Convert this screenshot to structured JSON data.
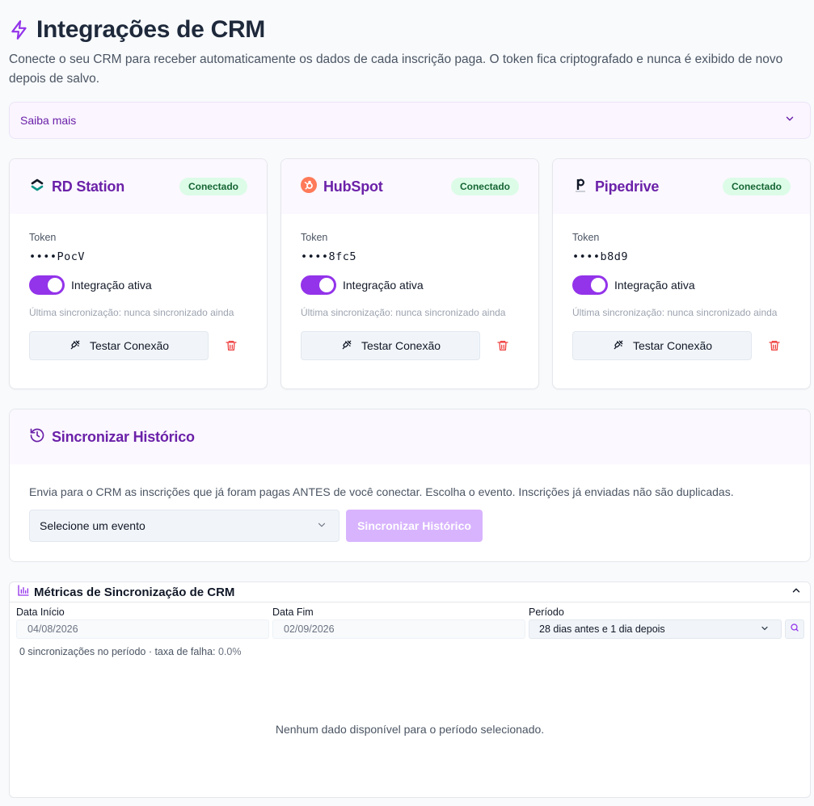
{
  "header": {
    "title": "Integrações de CRM",
    "subtitle": "Conecte o seu CRM para receber automaticamente os dados de cada inscrição paga. O token fica criptografado e nunca é exibido de novo depois de salvo."
  },
  "saiba_mais": {
    "label": "Saiba mais"
  },
  "integrations": [
    {
      "name": "RD Station",
      "status": "Conectado",
      "token_label": "Token",
      "token": "••••PocV",
      "toggle_label": "Integração ativa",
      "active": true,
      "last_sync": "Última sincronização: nunca sincronizado ainda",
      "test_label": "Testar Conexão"
    },
    {
      "name": "HubSpot",
      "status": "Conectado",
      "token_label": "Token",
      "token": "••••8fc5",
      "toggle_label": "Integração ativa",
      "active": true,
      "last_sync": "Última sincronização: nunca sincronizado ainda",
      "test_label": "Testar Conexão"
    },
    {
      "name": "Pipedrive",
      "status": "Conectado",
      "token_label": "Token",
      "token": "••••b8d9",
      "toggle_label": "Integração ativa",
      "active": true,
      "last_sync": "Última sincronização: nunca sincronizado ainda",
      "test_label": "Testar Conexão"
    }
  ],
  "history_sync": {
    "title": "Sincronizar Histórico",
    "description": "Envia para o CRM as inscrições que já foram pagas ANTES de você conectar. Escolha o evento. Inscrições já enviadas não são duplicadas.",
    "select_placeholder": "Selecione um evento",
    "button_label": "Sincronizar Histórico"
  },
  "metrics": {
    "title": "Métricas de Sincronização de CRM",
    "start_label": "Data Início",
    "start_value": "04/08/2026",
    "end_label": "Data Fim",
    "end_value": "02/09/2026",
    "period_label": "Período",
    "period_value": "28 dias antes e 1 dia depois",
    "summary_prefix": "0 sincronizações no período · taxa de falha: ",
    "failure_rate": "0.0%",
    "empty_message": "Nenhum dado disponível para o período selecionado."
  },
  "colors": {
    "accent": "#9333ea",
    "brand_text": "#6b21a8",
    "badge_bg": "#dcfce7",
    "badge_text": "#166534",
    "danger": "#ef4444"
  },
  "icons": {
    "title": "lightning-bolt-icon",
    "saiba": "chevron-down-icon",
    "rd": "rd-station-logo-icon",
    "hubspot": "hubspot-logo-icon",
    "pipedrive": "pipedrive-logo-icon",
    "test": "plug-icon",
    "delete": "trash-icon",
    "history": "history-clock-icon",
    "metrics": "bar-chart-icon",
    "collapse": "chevron-up-icon",
    "search": "search-icon"
  }
}
